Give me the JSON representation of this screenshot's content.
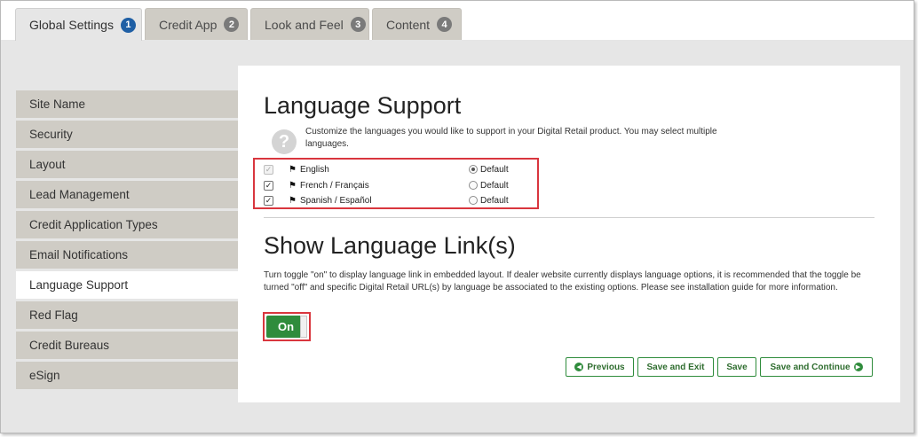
{
  "colors": {
    "accent_green": "#2f8c3c",
    "highlight_red": "#d9363e",
    "active_badge": "#1f5fa5"
  },
  "tabs": [
    {
      "label": "Global Settings",
      "badge": "1"
    },
    {
      "label": "Credit App",
      "badge": "2"
    },
    {
      "label": "Look and Feel",
      "badge": "3"
    },
    {
      "label": "Content",
      "badge": "4"
    }
  ],
  "sidebar": {
    "items": [
      {
        "label": "Site Name"
      },
      {
        "label": "Security"
      },
      {
        "label": "Layout"
      },
      {
        "label": "Lead Management"
      },
      {
        "label": "Credit Application Types"
      },
      {
        "label": "Email Notifications"
      },
      {
        "label": "Language Support"
      },
      {
        "label": "Red Flag"
      },
      {
        "label": "Credit Bureaus"
      },
      {
        "label": "eSign"
      }
    ]
  },
  "language_support": {
    "title": "Language Support",
    "description": "Customize the languages you would like to support in your Digital Retail product. You may select multiple languages.",
    "languages": [
      {
        "name": "English",
        "default_label": "Default"
      },
      {
        "name": "French / Français",
        "default_label": "Default"
      },
      {
        "name": "Spanish / Español",
        "default_label": "Default"
      }
    ]
  },
  "language_link": {
    "title": "Show Language Link(s)",
    "description": "Turn toggle \"on\" to display language link in embedded layout. If dealer website currently displays language options, it is recommended that the toggle be turned \"off\" and specific Digital Retail URL(s) by language be associated to the existing options. Please see installation guide for more information.",
    "toggle_label": "On"
  },
  "actions": {
    "previous": "Previous",
    "save_exit": "Save and Exit",
    "save": "Save",
    "save_continue": "Save and Continue"
  }
}
